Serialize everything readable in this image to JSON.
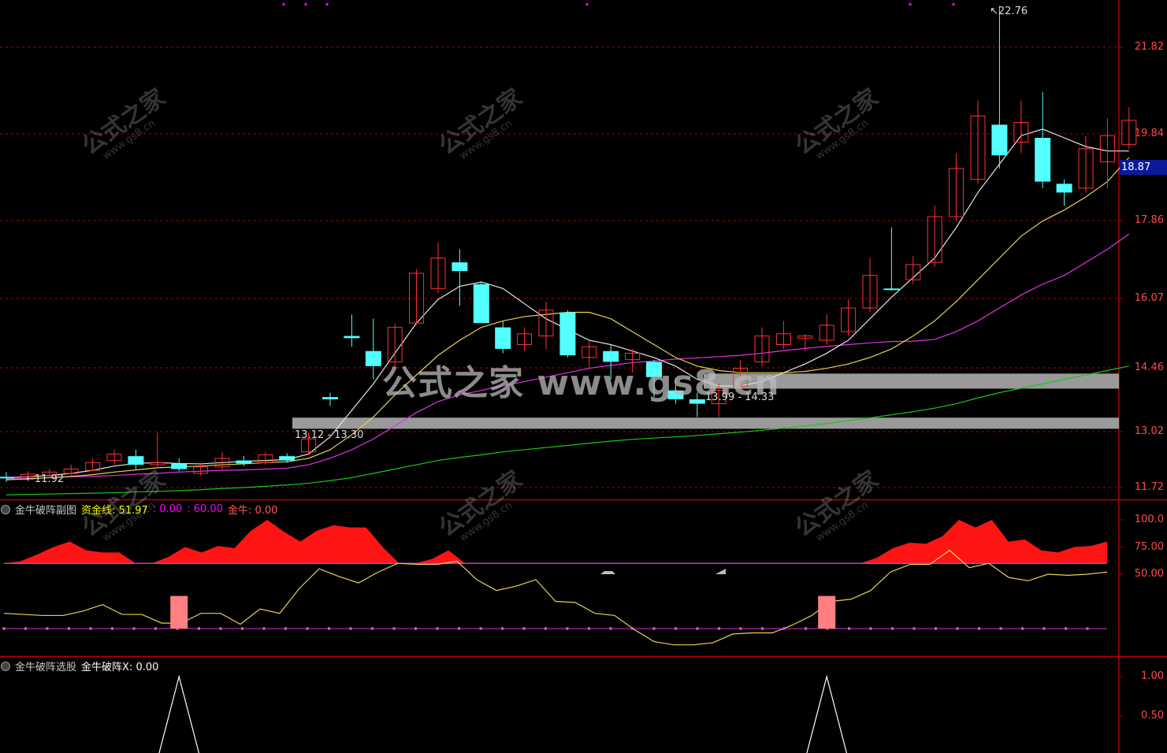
{
  "chart_data": [
    {
      "type": "candlestick",
      "title": "",
      "ylim": [
        11.5,
        23.2
      ],
      "y_ticks": [
        "21.82",
        "19.84",
        "17.86",
        "16.07",
        "14.46",
        "13.02",
        "11.72"
      ],
      "current_price": "18.87",
      "high_label": "22.76",
      "low_label": "11.92",
      "zone_labels": [
        "13.12 - 13.30",
        "13.99 - 14.33"
      ],
      "zones": [
        {
          "low": 13.12,
          "high": 13.3
        },
        {
          "low": 13.99,
          "high": 14.33
        }
      ],
      "candles": [
        [
          11.97,
          11.95,
          12.08,
          11.85
        ],
        [
          11.97,
          12.03,
          12.1,
          11.93
        ],
        [
          12.0,
          12.08,
          12.15,
          11.95
        ],
        [
          12.05,
          12.15,
          12.25,
          12.0
        ],
        [
          12.12,
          12.3,
          12.4,
          12.1
        ],
        [
          12.35,
          12.5,
          12.6,
          12.25
        ],
        [
          12.45,
          12.25,
          12.6,
          12.15
        ],
        [
          12.25,
          12.3,
          13.0,
          12.2
        ],
        [
          12.28,
          12.15,
          12.4,
          12.1
        ],
        [
          12.05,
          12.2,
          12.3,
          12.0
        ],
        [
          12.2,
          12.4,
          12.55,
          12.15
        ],
        [
          12.35,
          12.28,
          12.45,
          12.22
        ],
        [
          12.3,
          12.48,
          12.55,
          12.25
        ],
        [
          12.45,
          12.35,
          12.52,
          12.3
        ],
        [
          12.55,
          12.85,
          13.0,
          12.5
        ],
        [
          13.8,
          13.75,
          13.9,
          13.6
        ],
        [
          15.2,
          15.15,
          15.7,
          14.95
        ],
        [
          14.85,
          14.5,
          15.6,
          14.2
        ],
        [
          14.6,
          15.4,
          15.5,
          14.5
        ],
        [
          15.5,
          16.65,
          16.75,
          15.5
        ],
        [
          16.3,
          17.0,
          17.35,
          16.2
        ],
        [
          16.9,
          16.7,
          17.2,
          15.9
        ],
        [
          16.4,
          15.5,
          16.45,
          15.5
        ],
        [
          15.4,
          14.9,
          15.55,
          14.8
        ],
        [
          15.0,
          15.25,
          15.4,
          14.85
        ],
        [
          15.2,
          15.8,
          16.0,
          14.9
        ],
        [
          15.75,
          14.75,
          15.8,
          14.7
        ],
        [
          14.7,
          14.95,
          15.1,
          14.45
        ],
        [
          14.85,
          14.6,
          15.0,
          14.2
        ],
        [
          14.65,
          14.8,
          14.9,
          14.35
        ],
        [
          14.6,
          14.25,
          14.65,
          13.8
        ],
        [
          13.95,
          13.75,
          14.2,
          13.65
        ],
        [
          13.75,
          13.65,
          13.9,
          13.35
        ],
        [
          13.65,
          13.95,
          14.1,
          13.35
        ],
        [
          14.05,
          14.45,
          14.65,
          14.0
        ],
        [
          14.6,
          15.2,
          15.4,
          14.5
        ],
        [
          15.0,
          15.25,
          15.55,
          14.9
        ],
        [
          15.15,
          15.2,
          15.25,
          14.85
        ],
        [
          15.1,
          15.45,
          15.7,
          15.0
        ],
        [
          15.3,
          15.85,
          16.05,
          15.2
        ],
        [
          15.85,
          16.6,
          17.0,
          15.75
        ],
        [
          16.3,
          16.28,
          17.7,
          16.25
        ],
        [
          16.5,
          16.85,
          17.05,
          16.4
        ],
        [
          16.9,
          17.95,
          18.2,
          16.8
        ],
        [
          17.95,
          19.05,
          19.4,
          17.85
        ],
        [
          18.8,
          20.25,
          20.6,
          18.7
        ],
        [
          20.05,
          19.35,
          22.76,
          19.05
        ],
        [
          19.65,
          20.1,
          20.6,
          19.4
        ],
        [
          19.75,
          18.75,
          20.8,
          18.6
        ],
        [
          18.7,
          18.5,
          18.8,
          18.2
        ],
        [
          18.6,
          19.5,
          19.8,
          18.5
        ],
        [
          19.2,
          19.8,
          20.2,
          18.6
        ],
        [
          19.6,
          20.15,
          20.45,
          19.5
        ]
      ],
      "ma_white": [
        11.95,
        11.97,
        12.0,
        12.05,
        12.12,
        12.22,
        12.28,
        12.3,
        12.28,
        12.27,
        12.3,
        12.33,
        12.35,
        12.37,
        12.5,
        12.9,
        13.5,
        14.1,
        14.8,
        15.5,
        16.05,
        16.35,
        16.45,
        16.3,
        15.95,
        15.6,
        15.35,
        15.1,
        15.0,
        14.85,
        14.7,
        14.5,
        14.2,
        14.05,
        14.05,
        14.15,
        14.35,
        14.55,
        14.8,
        15.1,
        15.6,
        16.1,
        16.55,
        17.0,
        17.7,
        18.5,
        19.15,
        19.8,
        19.95,
        19.75,
        19.55,
        19.45,
        19.45
      ],
      "ma_yellow": [
        11.9,
        11.92,
        11.95,
        11.98,
        12.02,
        12.08,
        12.13,
        12.18,
        12.2,
        12.22,
        12.25,
        12.27,
        12.3,
        12.32,
        12.4,
        12.6,
        12.95,
        13.35,
        13.85,
        14.3,
        14.75,
        15.1,
        15.4,
        15.55,
        15.65,
        15.7,
        15.75,
        15.75,
        15.6,
        15.3,
        15.0,
        14.7,
        14.5,
        14.4,
        14.35,
        14.35,
        14.35,
        14.38,
        14.45,
        14.55,
        14.7,
        14.9,
        15.2,
        15.55,
        16.0,
        16.5,
        17.0,
        17.5,
        17.85,
        18.1,
        18.4,
        18.75,
        19.3
      ],
      "ma_magenta": [
        11.92,
        11.93,
        11.95,
        11.97,
        11.98,
        12.0,
        12.03,
        12.05,
        12.08,
        12.1,
        12.12,
        12.13,
        12.15,
        12.17,
        12.25,
        12.4,
        12.6,
        12.85,
        13.15,
        13.45,
        13.7,
        13.85,
        13.95,
        14.05,
        14.15,
        14.25,
        14.35,
        14.45,
        14.52,
        14.58,
        14.62,
        14.66,
        14.69,
        14.72,
        14.75,
        14.8,
        14.86,
        14.91,
        14.96,
        15.0,
        15.04,
        15.07,
        15.08,
        15.12,
        15.3,
        15.55,
        15.85,
        16.15,
        16.4,
        16.6,
        16.9,
        17.2,
        17.55
      ],
      "ma_green": [
        11.55,
        11.56,
        11.57,
        11.58,
        11.59,
        11.6,
        11.62,
        11.63,
        11.65,
        11.67,
        11.7,
        11.72,
        11.75,
        11.78,
        11.82,
        11.88,
        11.95,
        12.05,
        12.15,
        12.25,
        12.35,
        12.42,
        12.48,
        12.55,
        12.6,
        12.65,
        12.7,
        12.75,
        12.8,
        12.84,
        12.87,
        12.9,
        12.93,
        12.97,
        13.01,
        13.05,
        13.1,
        13.15,
        13.2,
        13.27,
        13.33,
        13.4,
        13.47,
        13.55,
        13.65,
        13.78,
        13.9,
        14.0,
        14.1,
        14.2,
        14.3,
        14.4,
        14.5
      ]
    },
    {
      "type": "area",
      "title": "金牛破阵副图",
      "ylim": [
        0,
        100
      ],
      "y_ticks": [
        "100.0",
        "75.00",
        "50.00"
      ],
      "legend": [
        {
          "name": "资金线",
          "value": "51.97",
          "color": "#ffff00"
        },
        {
          "name": "",
          "value": "0.00",
          "color": "#ff00ff"
        },
        {
          "name": "",
          "value": "60.00",
          "color": "#ff00ff"
        },
        {
          "name": "金牛",
          "value": "0.00",
          "color": "#ff5a5a"
        }
      ],
      "red_area": [
        60,
        62,
        68,
        75,
        80,
        72,
        70,
        70,
        60,
        60,
        66,
        75,
        70,
        76,
        74,
        90,
        100,
        89,
        80,
        90,
        95,
        93,
        93,
        75,
        60,
        60,
        64,
        72,
        60,
        60,
        60,
        60,
        60,
        60,
        60,
        60,
        60,
        60,
        60,
        60,
        60,
        60,
        60,
        60,
        60,
        60,
        60,
        60,
        60,
        60,
        60,
        60,
        60,
        65,
        74,
        79,
        78,
        85,
        100,
        93,
        100,
        80,
        82,
        72,
        70,
        75,
        76,
        80
      ],
      "fund_line": [
        14,
        13,
        12,
        12,
        16,
        22,
        13,
        13,
        5,
        5,
        14,
        14,
        4,
        18,
        14,
        37,
        55,
        48,
        42,
        52,
        60,
        59,
        59,
        62,
        45,
        35,
        39,
        45,
        25,
        24,
        14,
        12,
        -1,
        -12,
        -15,
        -15,
        -13,
        -5,
        -4,
        -4,
        3,
        12,
        25,
        27,
        35,
        52,
        59,
        59,
        72,
        56,
        60,
        47,
        44,
        50,
        49,
        50,
        51.97
      ],
      "baseline": 60,
      "dots_level": 0,
      "bars": [
        {
          "index": 8,
          "value": 30
        },
        {
          "index": 38,
          "value": 30
        }
      ]
    },
    {
      "type": "line",
      "title": "金牛破阵选股",
      "ylim": [
        0,
        1.2
      ],
      "y_ticks": [
        "1.00",
        "0.50"
      ],
      "legend": [
        {
          "name": "金牛破阵X",
          "value": "0.00",
          "color": "#ffffff"
        }
      ],
      "spikes": [
        8,
        38
      ]
    }
  ],
  "watermarks": [
    "公式之家",
    "www.gs8.cn"
  ],
  "center_watermark": "公式之家 www.gs8.cn",
  "colors": {
    "up": "#ff3232",
    "down": "#54ffff",
    "axis": "#b40000",
    "grid": "#b40000"
  }
}
